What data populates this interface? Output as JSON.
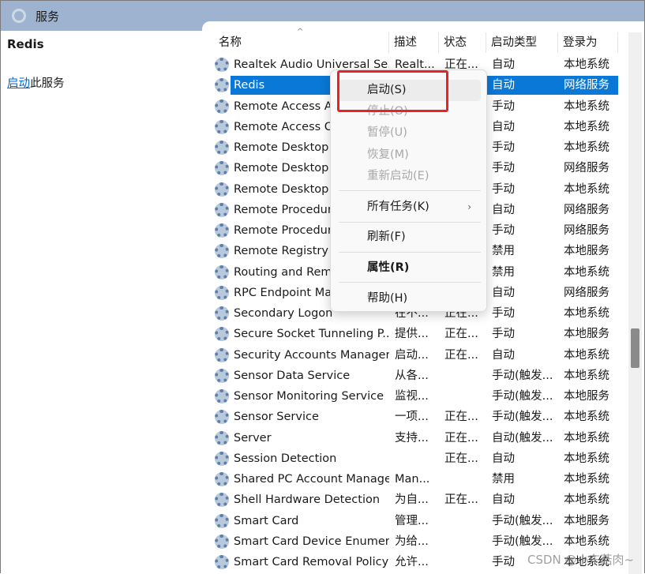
{
  "window": {
    "title": "服务"
  },
  "left_panel": {
    "service_name": "Redis",
    "action_link": "启动",
    "action_suffix": "此服务"
  },
  "columns": [
    "名称",
    "描述",
    "状态",
    "启动类型",
    "登录为"
  ],
  "rows": [
    [
      "Realtek Audio Universal Se...",
      "Realt...",
      "正在...",
      "自动",
      "本地系统"
    ],
    [
      "Redis",
      "",
      "",
      "自动",
      "网络服务"
    ],
    [
      "Remote Access Auto Connection Manager",
      "",
      "",
      "手动",
      "本地系统"
    ],
    [
      "Remote Access Connection Manager",
      "",
      "",
      "自动",
      "本地系统"
    ],
    [
      "Remote Desktop Configuration",
      "",
      "",
      "手动",
      "本地系统"
    ],
    [
      "Remote Desktop Services",
      "",
      "",
      "手动",
      "网络服务"
    ],
    [
      "Remote Desktop Services UserMode Port Redirector",
      "",
      "",
      "手动",
      "本地系统"
    ],
    [
      "Remote Procedure Call (RPC)",
      "",
      "",
      "自动",
      "网络服务"
    ],
    [
      "Remote Procedure Call (RPC) Locator",
      "",
      "",
      "手动",
      "网络服务"
    ],
    [
      "Remote Registry",
      "",
      "",
      "禁用",
      "本地服务"
    ],
    [
      "Routing and Remote Access",
      "",
      "",
      "禁用",
      "本地系统"
    ],
    [
      "RPC Endpoint Mapper",
      "",
      "",
      "自动",
      "网络服务"
    ],
    [
      "Secondary Logon",
      "在不...",
      "正在...",
      "手动",
      "本地系统"
    ],
    [
      "Secure Socket Tunneling P...",
      "提供...",
      "正在...",
      "手动",
      "本地服务"
    ],
    [
      "Security Accounts Manager",
      "启动...",
      "正在...",
      "自动",
      "本地系统"
    ],
    [
      "Sensor Data Service",
      "从各...",
      "",
      "手动(触发...",
      "本地系统"
    ],
    [
      "Sensor Monitoring Service",
      "监视...",
      "",
      "手动(触发...",
      "本地服务"
    ],
    [
      "Sensor Service",
      "一项...",
      "正在...",
      "手动(触发...",
      "本地系统"
    ],
    [
      "Server",
      "支持...",
      "正在...",
      "自动(触发...",
      "本地系统"
    ],
    [
      "Session Detection",
      "",
      "正在...",
      "自动",
      "本地系统"
    ],
    [
      "Shared PC Account Manager",
      "Man...",
      "",
      "禁用",
      "本地系统"
    ],
    [
      "Shell Hardware Detection",
      "为自...",
      "正在...",
      "自动",
      "本地系统"
    ],
    [
      "Smart Card",
      "管理...",
      "",
      "手动(触发...",
      "本地服务"
    ],
    [
      "Smart Card Device Enumer...",
      "为给...",
      "",
      "手动(触发...",
      "本地系统"
    ],
    [
      "Smart Card Removal Policy",
      "允许...",
      "",
      "手动",
      "本地系统"
    ]
  ],
  "selected_row": 1,
  "context_menu": {
    "items": [
      {
        "label": "启动(S)",
        "disabled": false,
        "hover": true
      },
      {
        "label": "停止(O)",
        "disabled": true
      },
      {
        "label": "暂停(U)",
        "disabled": true
      },
      {
        "label": "恢复(M)",
        "disabled": true
      },
      {
        "label": "重新启动(E)",
        "disabled": true
      },
      {
        "label": "所有任务(K)",
        "submenu": true
      },
      {
        "label": "刷新(F)"
      },
      {
        "label": "属性(R)",
        "bold": true
      },
      {
        "label": "帮助(H)"
      }
    ]
  },
  "colors": {
    "title_bar": "#9db3cf",
    "selection": "#0a78d7",
    "highlight_box": "#f02020"
  },
  "watermark": "CSDN @小东菇肉~"
}
